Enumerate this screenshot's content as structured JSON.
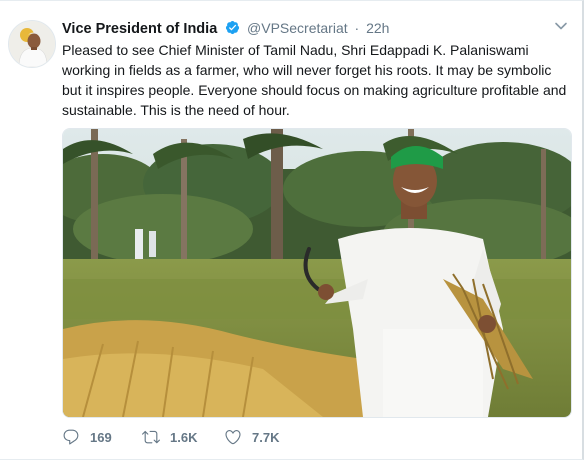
{
  "tweet": {
    "author_name": "Vice President of India",
    "author_handle": "@VPSecretariat",
    "separator": "·",
    "timestamp": "22h",
    "text": "Pleased to see Chief Minister of Tamil Nadu, Shri Edappadi K. Palaniswami working in fields as a farmer, who will never forget his roots. It may be symbolic but it inspires people. Everyone should focus on making agriculture profitable and sustainable. This is the need of hour.",
    "actions": {
      "reply_count": "169",
      "retweet_count": "1.6K",
      "like_count": "7.7K"
    }
  },
  "icons": {
    "verified": "verified-badge-icon",
    "caret": "chevron-down-icon",
    "reply": "reply-icon",
    "retweet": "retweet-icon",
    "like": "heart-icon"
  },
  "colors": {
    "verified_blue": "#1da1f2",
    "secondary_text": "#657786",
    "primary_text": "#14171a"
  }
}
